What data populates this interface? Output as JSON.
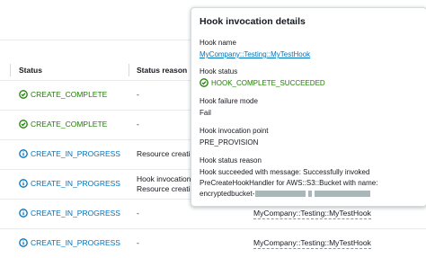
{
  "table": {
    "headers": {
      "status": "Status",
      "status_reason": "Status reason"
    },
    "rows": [
      {
        "status": "CREATE_COMPLETE",
        "status_kind": "complete",
        "reason": [
          "-"
        ],
        "hook": ""
      },
      {
        "status": "CREATE_COMPLETE",
        "status_kind": "complete",
        "reason": [
          "-"
        ],
        "hook": ""
      },
      {
        "status": "CREATE_IN_PROGRESS",
        "status_kind": "progress",
        "reason": [
          "Resource creation"
        ],
        "hook": ""
      },
      {
        "status": "CREATE_IN_PROGRESS",
        "status_kind": "progress",
        "reason": [
          "Hook invocations",
          "Resource creation"
        ],
        "hook": ""
      },
      {
        "status": "CREATE_IN_PROGRESS",
        "status_kind": "progress",
        "reason": [
          "-"
        ],
        "hook": "MyCompany::Testing::MyTestHook"
      },
      {
        "status": "CREATE_IN_PROGRESS",
        "status_kind": "progress",
        "reason": [
          "-"
        ],
        "hook": "MyCompany::Testing::MyTestHook"
      }
    ]
  },
  "popover": {
    "title": "Hook invocation details",
    "hook_name_label": "Hook name",
    "hook_name_value": "MyCompany::Testing::MyTestHook",
    "hook_status_label": "Hook status",
    "hook_status_value": "HOOK_COMPLETE_SUCCEEDED",
    "failure_mode_label": "Hook failure mode",
    "failure_mode_value": "Fail",
    "invocation_point_label": "Hook invocation point",
    "invocation_point_value": "PRE_PROVISION",
    "status_reason_label": "Hook status reason",
    "status_reason_line1": "Hook succeeded with message: Successfully invoked",
    "status_reason_line2": "PreCreateHookHandler for AWS::S3::Bucket with name:",
    "status_reason_line3_prefix": "encryptedbucket-"
  },
  "colors": {
    "success": "#1d8102",
    "in_progress": "#0073bb",
    "link": "#0073bb"
  },
  "icons": {
    "complete": "check-circle-icon",
    "progress": "info-circle-icon"
  }
}
